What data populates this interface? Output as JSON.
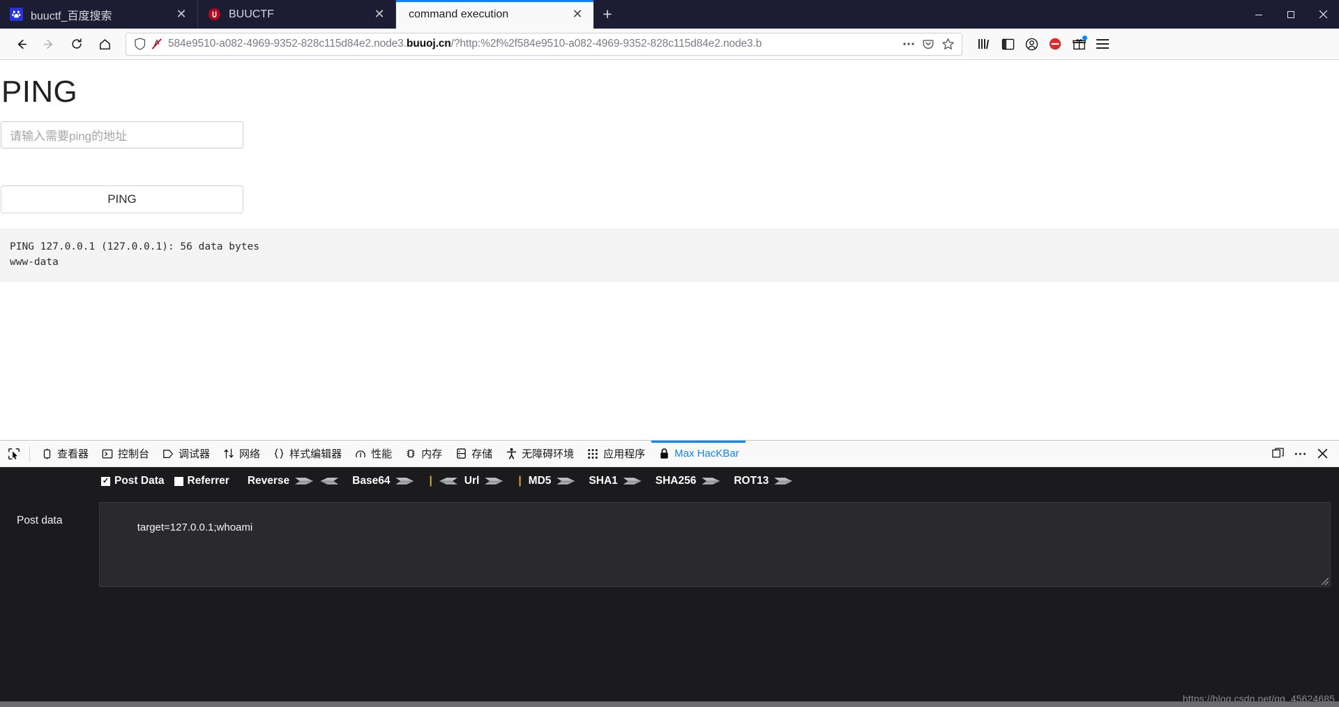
{
  "browser": {
    "tabs": [
      {
        "title": "buuctf_百度搜索",
        "favicon": "baidu-icon",
        "active": false,
        "closable": true
      },
      {
        "title": "BUUCTF",
        "favicon": "buuctf-icon",
        "active": false,
        "closable": true
      },
      {
        "title": "command execution",
        "favicon": "none",
        "active": true,
        "closable": true
      }
    ],
    "new_tab_label": "+",
    "window_controls": {
      "minimize": "—",
      "maximize": "❑",
      "close": "✕"
    },
    "nav": {
      "back_label": "←",
      "forward_label": "→",
      "reload_label": "↻",
      "home_label": "⌂"
    },
    "url": {
      "prefix": "584e9510-a082-4969-9352-828c115d84e2.node3.",
      "domain": "buuoj.cn",
      "suffix": "/?http:%2f%2f584e9510-a082-4969-9352-828c115d84e2.node3.b",
      "shield_icon": "shield-icon",
      "tracker_icon": "tracker-blocked-icon",
      "page_actions_icon": "ellipsis-icon",
      "pocket_icon": "pocket-icon",
      "bookmark_icon": "star-icon"
    },
    "toolbar_right": [
      {
        "name": "library-icon",
        "glyph": "‖‖"
      },
      {
        "name": "sidebar-icon",
        "glyph": "▧"
      },
      {
        "name": "account-icon",
        "glyph": "●"
      },
      {
        "name": "adblock-icon",
        "glyph": "⊘"
      },
      {
        "name": "extension-gift-icon",
        "glyph": "⌘"
      },
      {
        "name": "menu-hamburger-icon",
        "glyph": "☰"
      }
    ]
  },
  "page": {
    "title": "PING",
    "input_placeholder": "请输入需要ping的地址",
    "input_value": "",
    "submit_label": "PING",
    "output": "PING 127.0.0.1 (127.0.0.1): 56 data bytes\nwww-data"
  },
  "devtools": {
    "picker_icon": "element-picker-icon",
    "tabs": [
      {
        "label": "查看器",
        "icon": "inspector-icon",
        "active": false
      },
      {
        "label": "控制台",
        "icon": "console-icon",
        "active": false
      },
      {
        "label": "调试器",
        "icon": "debugger-icon",
        "active": false
      },
      {
        "label": "网络",
        "icon": "network-icon",
        "active": false
      },
      {
        "label": "样式编辑器",
        "icon": "style-editor-icon",
        "active": false
      },
      {
        "label": "性能",
        "icon": "performance-icon",
        "active": false
      },
      {
        "label": "内存",
        "icon": "memory-icon",
        "active": false
      },
      {
        "label": "存储",
        "icon": "storage-icon",
        "active": false
      },
      {
        "label": "无障碍环境",
        "icon": "accessibility-icon",
        "active": false
      },
      {
        "label": "应用程序",
        "icon": "application-icon",
        "active": false
      },
      {
        "label": "Max HacKBar",
        "icon": "lock-icon",
        "active": true
      }
    ],
    "active_tab_color": "#0a84ff",
    "right_buttons": [
      {
        "name": "dock-layout-icon",
        "glyph": "⧉"
      },
      {
        "name": "devtools-menu-icon",
        "glyph": "…"
      },
      {
        "name": "devtools-close-icon",
        "glyph": "✕"
      }
    ]
  },
  "hackbar": {
    "post_data": {
      "label": "Post Data",
      "checked": true
    },
    "referrer": {
      "label": "Referrer",
      "checked": false
    },
    "actions": [
      {
        "label": "Reverse",
        "buttons": [
          "encode",
          "decode"
        ]
      },
      {
        "label": "Base64",
        "buttons": [
          "encode"
        ]
      },
      {
        "label": "Url",
        "buttons": [
          "decode",
          "encode"
        ]
      },
      {
        "label": "MD5",
        "buttons": [
          "encode"
        ]
      },
      {
        "label": "SHA1",
        "buttons": [
          "encode"
        ]
      },
      {
        "label": "SHA256",
        "buttons": [
          "encode"
        ]
      },
      {
        "label": "ROT13",
        "buttons": [
          "encode"
        ]
      }
    ],
    "field_label": "Post data",
    "field_value": "target=127.0.0.1;whoami"
  },
  "watermark": "https://blog.csdn.net/qq_45624685"
}
